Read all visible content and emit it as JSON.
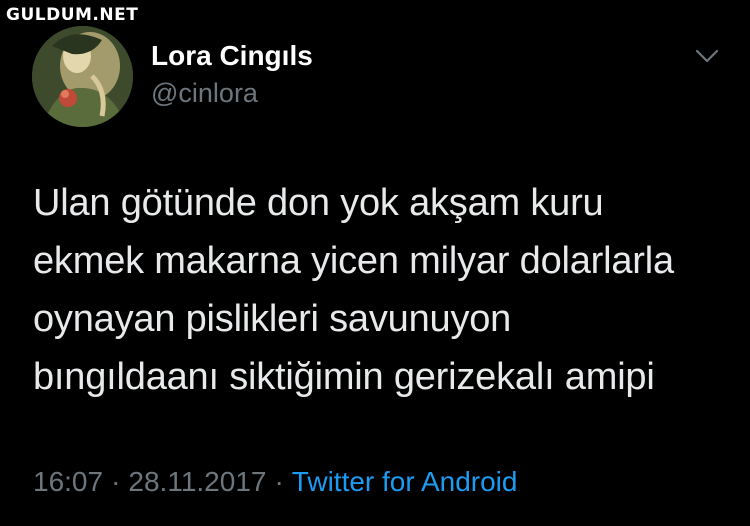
{
  "watermark": "GULDUM.NET",
  "author": {
    "name": "Lora Cingıls",
    "handle": "@cinlora",
    "avatar_icon": "profile-avatar-painting"
  },
  "menu_icon": "chevron-down-icon",
  "tweet": {
    "lines": [
      "Ulan götünde don yok akşam kuru",
      "ekmek makarna yicen milyar dolarlarla",
      "oynayan pislikleri savunuyon",
      "bıngıldaanı siktiğimin gerizekalı amipi"
    ]
  },
  "meta": {
    "time": "16:07",
    "separator": "·",
    "date": "28.11.2017",
    "source": "Twitter for Android"
  },
  "colors": {
    "background": "#000000",
    "text": "#e7e9ea",
    "muted": "#6e767d",
    "link": "#1d9bf0"
  }
}
